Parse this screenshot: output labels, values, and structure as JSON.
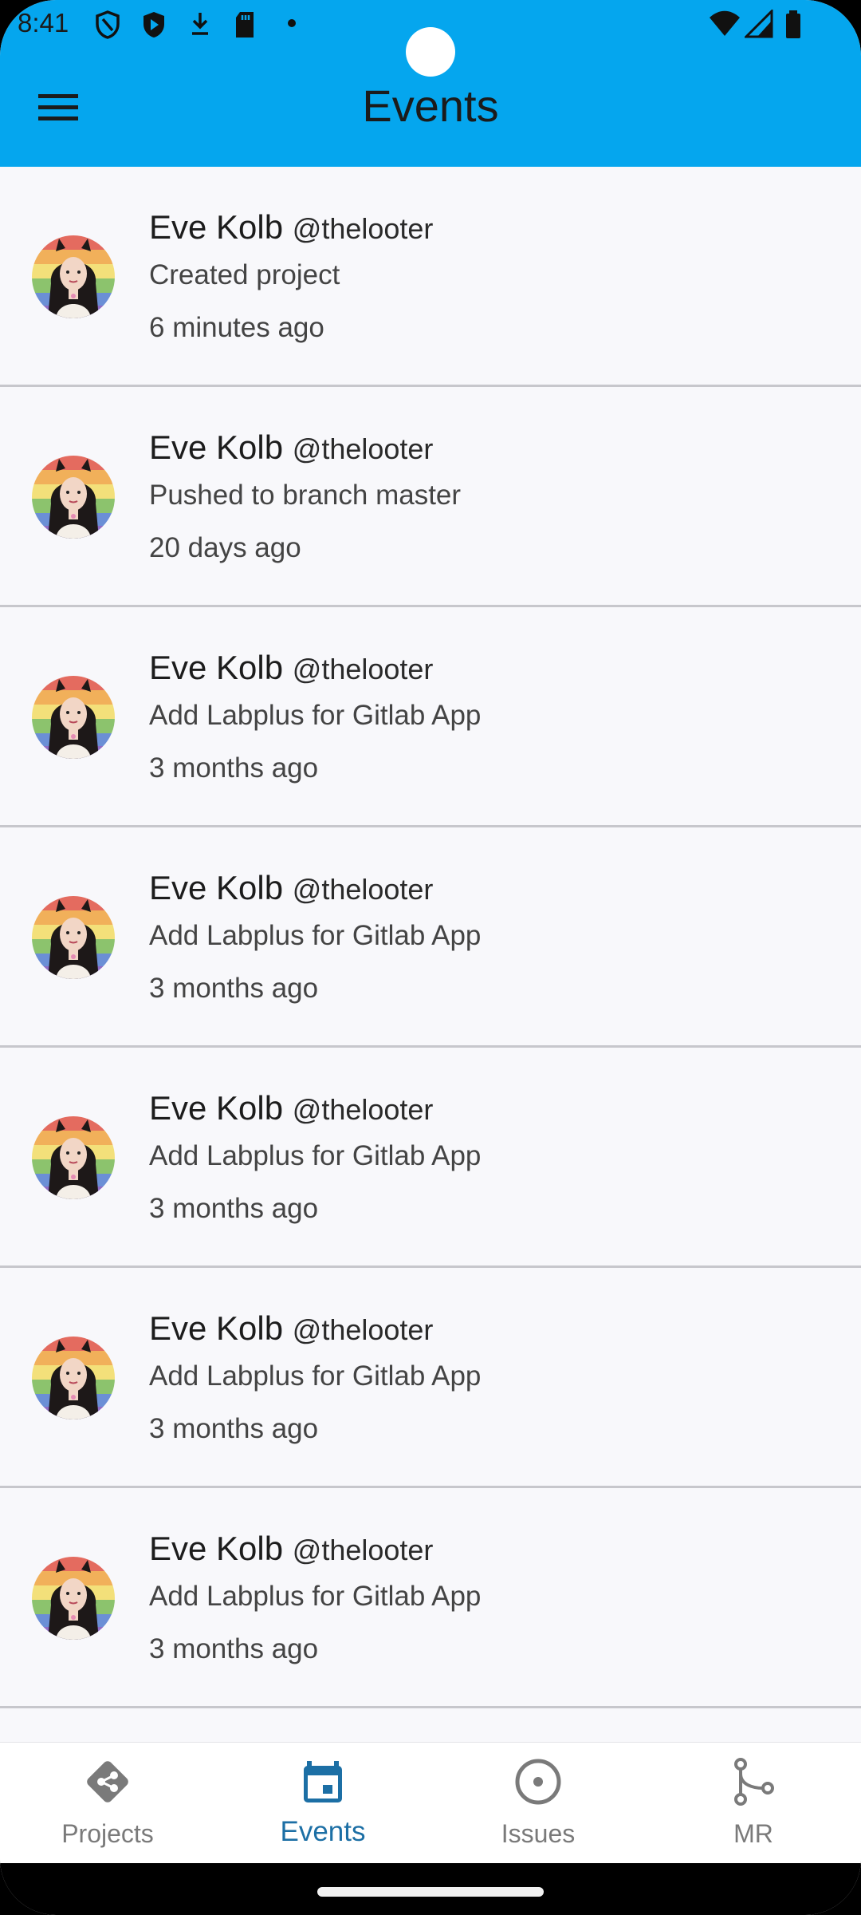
{
  "status_bar": {
    "time": "8:41",
    "icons_left": [
      "shield-outline-icon",
      "play-shield-icon",
      "download-icon",
      "sd-card-icon",
      "dot-icon"
    ],
    "icons_right": [
      "wifi-icon",
      "signal-icon",
      "battery-icon"
    ]
  },
  "app_bar": {
    "title": "Events",
    "menu_icon": "hamburger-menu-icon",
    "background": "#05a6ee"
  },
  "events": [
    {
      "name": "Eve Kolb",
      "handle": "@thelooter",
      "action": "Created project",
      "time": "6 minutes ago"
    },
    {
      "name": "Eve Kolb",
      "handle": "@thelooter",
      "action": "Pushed to branch master",
      "time": "20 days ago"
    },
    {
      "name": "Eve Kolb",
      "handle": "@thelooter",
      "action": "Add Labplus for Gitlab App",
      "time": "3 months ago"
    },
    {
      "name": "Eve Kolb",
      "handle": "@thelooter",
      "action": "Add Labplus for Gitlab App",
      "time": "3 months ago"
    },
    {
      "name": "Eve Kolb",
      "handle": "@thelooter",
      "action": "Add Labplus for Gitlab App",
      "time": "3 months ago"
    },
    {
      "name": "Eve Kolb",
      "handle": "@thelooter",
      "action": "Add Labplus for Gitlab App",
      "time": "3 months ago"
    },
    {
      "name": "Eve Kolb",
      "handle": "@thelooter",
      "action": "Add Labplus for Gitlab App",
      "time": "3 months ago"
    }
  ],
  "bottom_nav": {
    "items": [
      {
        "label": "Projects",
        "icon": "git-icon",
        "active": false
      },
      {
        "label": "Events",
        "icon": "calendar-icon",
        "active": true
      },
      {
        "label": "Issues",
        "icon": "issue-circle-icon",
        "active": false
      },
      {
        "label": "MR",
        "icon": "merge-request-icon",
        "active": false
      }
    ],
    "active_color": "#1c6fa5",
    "inactive_color": "#7a7a7a"
  }
}
